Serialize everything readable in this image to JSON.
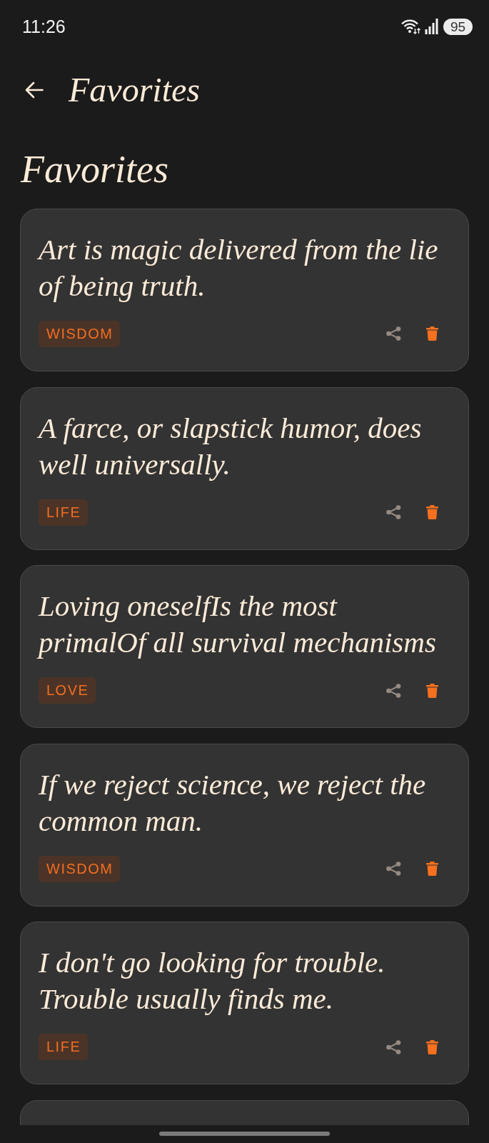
{
  "status_bar": {
    "time": "11:26",
    "battery": "95"
  },
  "app_bar": {
    "title": "Favorites"
  },
  "heading": "Favorites",
  "quotes": [
    {
      "text": "Art is magic delivered from the lie of being truth.",
      "tag": "WISDOM"
    },
    {
      "text": "A farce, or slapstick humor, does well universally.",
      "tag": "LIFE"
    },
    {
      "text": "Loving oneselfIs the most primalOf all survival mechanisms",
      "tag": "LOVE"
    },
    {
      "text": "If we reject science, we reject the common man.",
      "tag": "WISDOM"
    },
    {
      "text": "I don't go looking for trouble. Trouble usually finds me.",
      "tag": "LIFE"
    }
  ],
  "cut_off_card": true
}
